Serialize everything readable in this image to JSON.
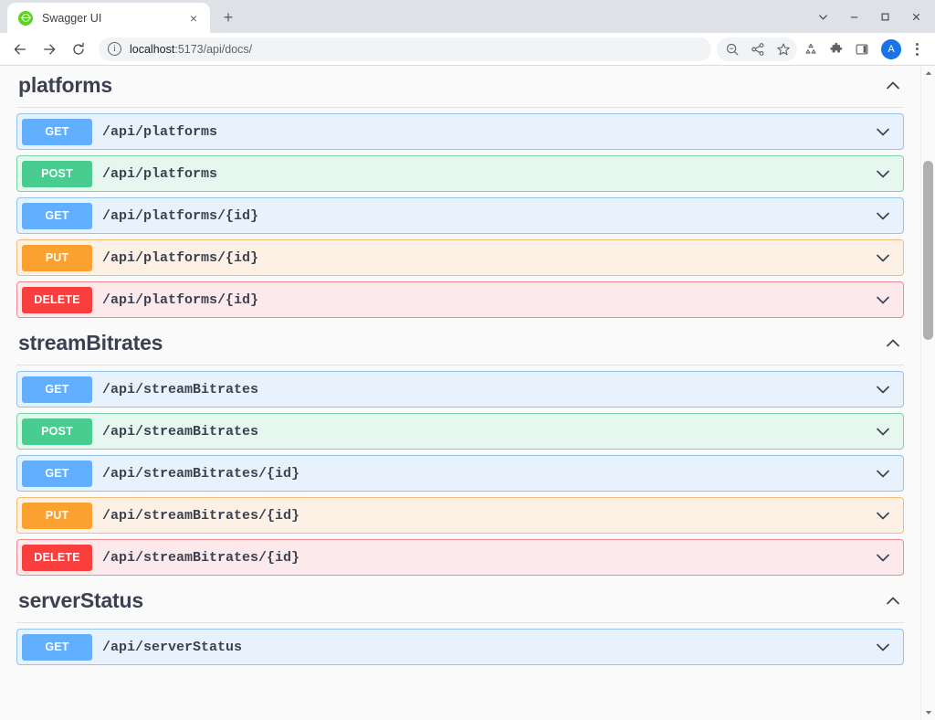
{
  "browser": {
    "tab": {
      "title": "Swagger UI",
      "favicon_name": "swagger-logo-icon",
      "close_label": "×"
    },
    "new_tab_label": "+",
    "window_controls": [
      {
        "name": "chrome-menu-chevron",
        "glyph": "⌄"
      },
      {
        "name": "minimize",
        "glyph": "–"
      },
      {
        "name": "maximize",
        "glyph": "□"
      },
      {
        "name": "close",
        "glyph": "×"
      }
    ],
    "nav": {
      "back_label": "←",
      "forward_label": "→",
      "reload_label": "⟳"
    },
    "omnibox": {
      "info_glyph": "ⓘ",
      "url_host": "localhost",
      "url_rest": ":5173/api/docs/",
      "full_url": "localhost:5173/api/docs/"
    },
    "toolbar_icons": [
      "zoom-icon",
      "share-icon",
      "bookmark-star-icon",
      "recycle-icon",
      "extensions-puzzle-icon",
      "side-panel-icon"
    ],
    "profile": {
      "initial": "A",
      "color": "#1a73e8"
    },
    "menu_name": "three-dot-menu"
  },
  "colors": {
    "get": "#61affe",
    "post": "#49cc90",
    "put": "#fca130",
    "delete": "#f93e3e",
    "text": "#3b4151",
    "page_bg": "#fafafa"
  },
  "sections": [
    {
      "title": "platforms",
      "collapse_glyph": "∧",
      "expanded": true,
      "operations": [
        {
          "method": "GET",
          "method_class": "get",
          "path": "/api/platforms"
        },
        {
          "method": "POST",
          "method_class": "post",
          "path": "/api/platforms"
        },
        {
          "method": "GET",
          "method_class": "get",
          "path": "/api/platforms/{id}"
        },
        {
          "method": "PUT",
          "method_class": "put",
          "path": "/api/platforms/{id}"
        },
        {
          "method": "DELETE",
          "method_class": "delete",
          "path": "/api/platforms/{id}"
        }
      ]
    },
    {
      "title": "streamBitrates",
      "collapse_glyph": "∧",
      "expanded": true,
      "operations": [
        {
          "method": "GET",
          "method_class": "get",
          "path": "/api/streamBitrates"
        },
        {
          "method": "POST",
          "method_class": "post",
          "path": "/api/streamBitrates"
        },
        {
          "method": "GET",
          "method_class": "get",
          "path": "/api/streamBitrates/{id}"
        },
        {
          "method": "PUT",
          "method_class": "put",
          "path": "/api/streamBitrates/{id}"
        },
        {
          "method": "DELETE",
          "method_class": "delete",
          "path": "/api/streamBitrates/{id}"
        }
      ]
    },
    {
      "title": "serverStatus",
      "collapse_glyph": "∧",
      "expanded": true,
      "operations": [
        {
          "method": "GET",
          "method_class": "get",
          "path": "/api/serverStatus"
        }
      ]
    }
  ],
  "scrollbar": {
    "up_glyph": "▲",
    "down_glyph": "▼"
  }
}
